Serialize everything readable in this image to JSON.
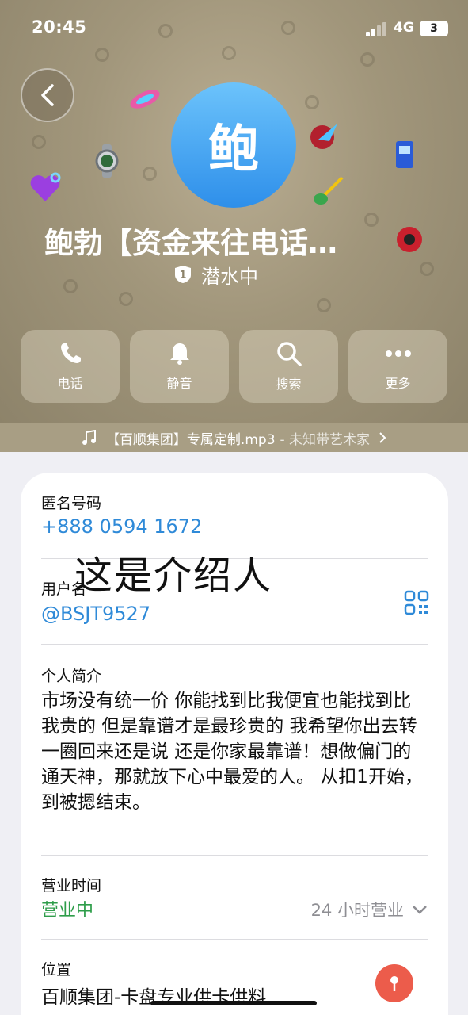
{
  "status_bar": {
    "time": "20:45",
    "network": "4G",
    "battery": "3"
  },
  "profile": {
    "avatar_char": "鲍",
    "name": "鲍勃【资金来往电话…",
    "status": "潜水中",
    "badge_number": "1"
  },
  "actions": [
    {
      "label": "电话",
      "icon": "phone-icon"
    },
    {
      "label": "静音",
      "icon": "bell-icon"
    },
    {
      "label": "搜索",
      "icon": "search-icon"
    },
    {
      "label": "更多",
      "icon": "more-icon"
    }
  ],
  "music": {
    "title": "【百顺集团】专属定制.mp3",
    "artist": "- 未知带艺术家"
  },
  "info": {
    "anon_label": "匿名号码",
    "anon_value": "+888 0594 1672",
    "overlay_text": "这是介绍人",
    "username_label": "用户名",
    "username_value": "@BSJT9527",
    "bio_label": "个人简介",
    "bio_value": "市场没有统一价 你能找到比我便宜也能找到比我贵的 但是靠谱才是最珍贵的 我希望你出去转一圈回来还是说 还是你家最靠谱！想做偏门的通天神，那就放下心中最爱的人。 从扣1开始，到被摁结束。",
    "hours_label": "营业时间",
    "hours_status": "营业中",
    "hours_detail": "24 小时营业",
    "location_label": "位置",
    "location_value": "百顺集团-卡盘专业供卡供料"
  },
  "colors": {
    "accent": "#2f8ad8",
    "open_green": "#2e9d4a",
    "header": "#a1967b",
    "pin": "#ec5c4b"
  }
}
